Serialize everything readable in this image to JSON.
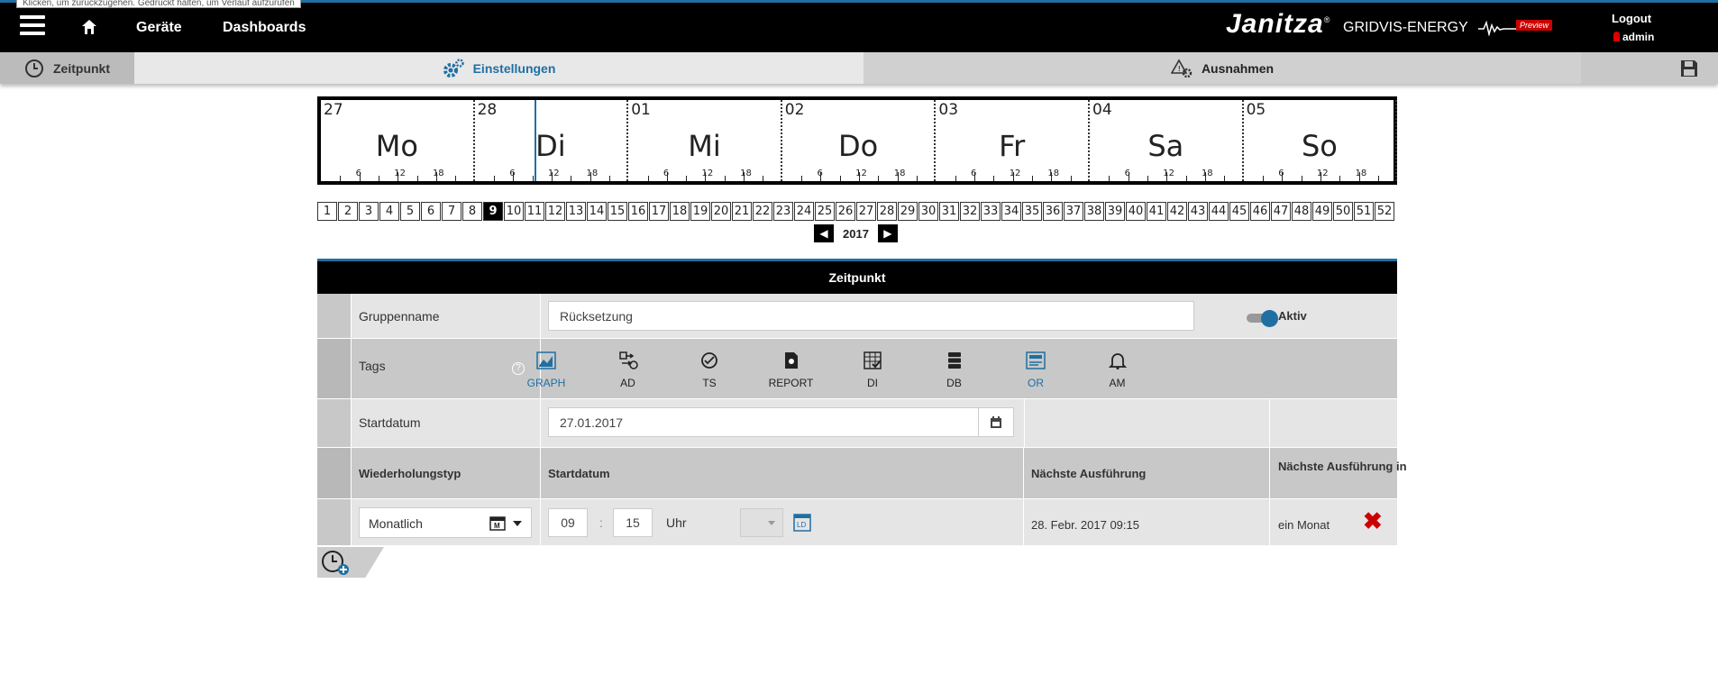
{
  "top": {
    "tooltip": "Klicken, um zurückzugehen. Gedrückt halten, um Verlauf aufzurufen",
    "nav": [
      "Geräte",
      "Dashboards"
    ],
    "logo": "Janitza",
    "logo_reg": "®",
    "product": "GRIDVIS-ENERGY",
    "preview": "Preview",
    "logout": "Logout",
    "user": "admin"
  },
  "tabs": {
    "zeitpunkt": "Zeitpunkt",
    "einstellungen": "Einstellungen",
    "ausnahmen": "Ausnahmen"
  },
  "timeline": {
    "days": [
      {
        "num": "27",
        "name": "Mo"
      },
      {
        "num": "28",
        "name": "Di"
      },
      {
        "num": "01",
        "name": "Mi"
      },
      {
        "num": "02",
        "name": "Do"
      },
      {
        "num": "03",
        "name": "Fr"
      },
      {
        "num": "04",
        "name": "Sa"
      },
      {
        "num": "05",
        "name": "So"
      }
    ],
    "tick_labels": [
      "6",
      "12",
      "18"
    ]
  },
  "weeks": {
    "count": 52,
    "selected": 9
  },
  "year_nav": {
    "year": "2017",
    "prev": "◀",
    "next": "▶"
  },
  "panel": {
    "title": "Zeitpunkt",
    "group_label": "Gruppenname",
    "group_value": "Rücksetzung",
    "active_label": "Aktiv",
    "tags_label": "Tags",
    "help": "?",
    "tags": [
      "GRAPH",
      "AD",
      "TS",
      "REPORT",
      "DI",
      "DB",
      "OR",
      "AM"
    ],
    "start_label": "Startdatum",
    "start_value": "27.01.2017",
    "table_headers": [
      "Wiederholungstyp",
      "Startdatum",
      "Nächste Ausführung",
      "Nächste Ausführung in"
    ],
    "repeat_type": "Monatlich",
    "hour": "09",
    "sep": ":",
    "minute": "15",
    "uhr": "Uhr",
    "next_exec": "28. Febr. 2017 09:15",
    "next_exec_in": "ein Monat",
    "delete": "✖"
  },
  "colors": {
    "accent": "#1f6fa3",
    "danger": "#cc0000",
    "row_light": "#e5e5e5",
    "row_dark": "#c8c8c8"
  }
}
